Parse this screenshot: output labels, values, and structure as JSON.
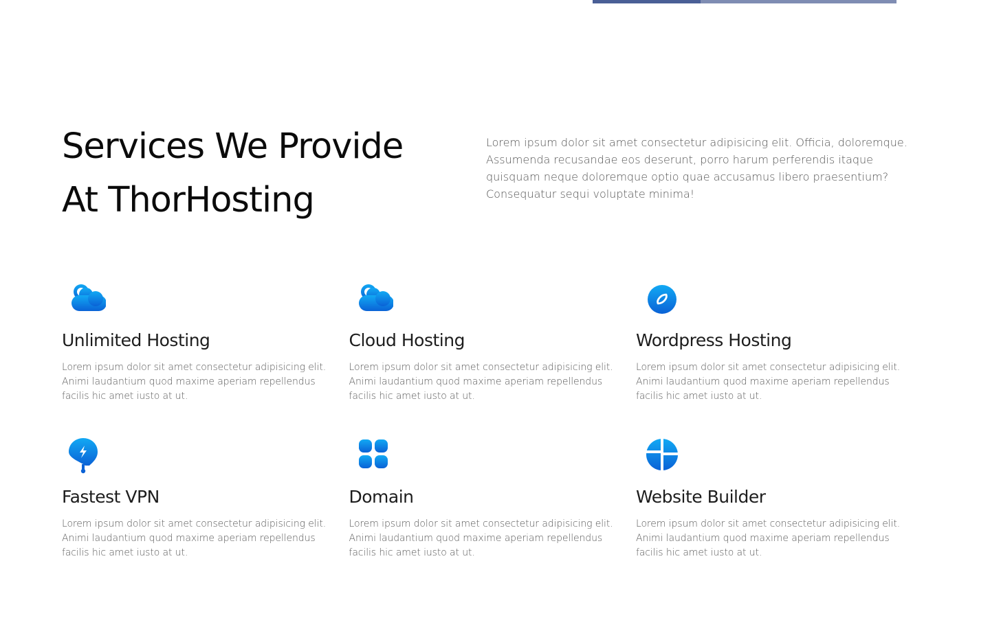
{
  "top_strip": {
    "progress": 0.355
  },
  "section": {
    "title_line1": "Services We Provide",
    "title_line2": "At ThorHosting",
    "intro": "Lorem ipsum dolor sit amet consectetur adipisicing elit. Officia, doloremque. Assumenda recusandae eos deserunt, porro harum perferendis itaque quisquam neque doloremque optio quae accusamus libero praesentium? Consequatur sequi voluptate minima!"
  },
  "colors": {
    "accent_light": "#11a7f3",
    "accent_dark": "#0a63d8"
  },
  "services": [
    {
      "icon": "cloud-icon",
      "title": "Unlimited Hosting",
      "description": "Lorem ipsum dolor sit amet consectetur adipisicing elit. Animi laudantium quod maxime aperiam repellendus facilis hic amet iusto at ut."
    },
    {
      "icon": "cloud-icon",
      "title": "Cloud Hosting",
      "description": "Lorem ipsum dolor sit amet consectetur adipisicing elit. Animi laudantium quod maxime aperiam repellendus facilis hic amet iusto at ut."
    },
    {
      "icon": "compass-icon",
      "title": "Wordpress Hosting",
      "description": "Lorem ipsum dolor sit amet consectetur adipisicing elit. Animi laudantium quod maxime aperiam repellendus facilis hic amet iusto at ut."
    },
    {
      "icon": "lightning-pin-icon",
      "title": "Fastest VPN",
      "description": "Lorem ipsum dolor sit amet consectetur adipisicing elit. Animi laudantium quod maxime aperiam repellendus facilis hic amet iusto at ut."
    },
    {
      "icon": "grid-icon",
      "title": "Domain",
      "description": "Lorem ipsum dolor sit amet consectetur adipisicing elit. Animi laudantium quod maxime aperiam repellendus facilis hic amet iusto at ut."
    },
    {
      "icon": "pie-chart-icon",
      "title": "Website Builder",
      "description": "Lorem ipsum dolor sit amet consectetur adipisicing elit. Animi laudantium quod maxime aperiam repellendus facilis hic amet iusto at ut."
    }
  ]
}
